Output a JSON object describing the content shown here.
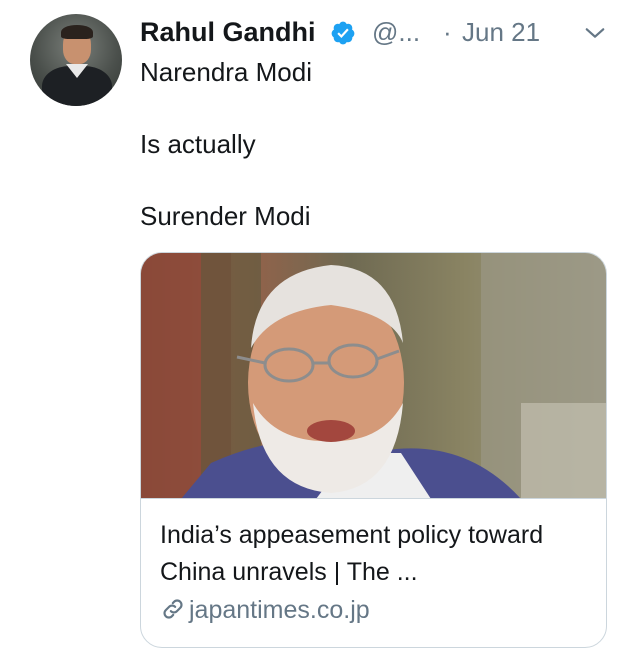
{
  "tweet": {
    "author": {
      "name": "Rahul Gandhi",
      "handle": "@...",
      "verified": true
    },
    "separator": "·",
    "date": "Jun 21",
    "text_lines": [
      "Narendra Modi",
      "Is actually",
      "Surender Modi"
    ]
  },
  "card": {
    "title": "India’s appeasement policy toward China unravels | The ...",
    "domain": "japantimes.co.jp"
  },
  "colors": {
    "text_primary": "#14171a",
    "text_secondary": "#657786",
    "verified_blue": "#1da1f2",
    "border": "#ccd6dd"
  },
  "icons": {
    "verified": "verified-badge-icon",
    "more": "chevron-down-icon",
    "link": "link-icon"
  }
}
